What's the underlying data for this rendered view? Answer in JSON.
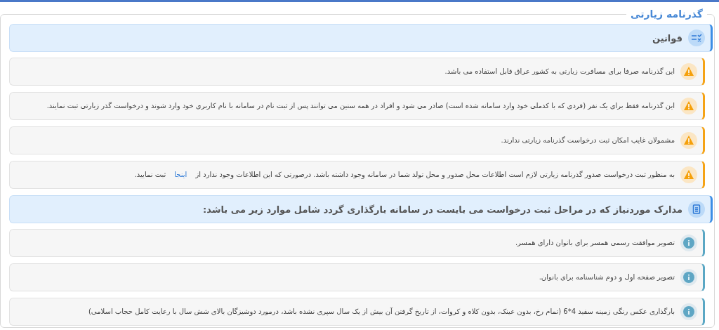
{
  "panel": {
    "title": "گذرنامه زیارتی"
  },
  "sections": [
    {
      "kind": "rules",
      "title": "قوانین",
      "items": [
        {
          "kind": "warning",
          "text": "این گذرنامه صرفا برای مسافرت زیارتی به کشور عراق قابل استفاده می باشد."
        },
        {
          "kind": "warning",
          "text": "این گذرنامه فقط برای یک نفر (فردی که با کدملی خود وارد سامانه شده است) صادر می شود و افراد در همه سنین می توانند پس از ثبت نام در سامانه با نام کاربری خود وارد شوند و درخواست گذر زیارتی ثبت نمایند."
        },
        {
          "kind": "warning",
          "text": "مشمولان غایب امکان ثبت درخواست گذرنامه زیارتی ندارند."
        },
        {
          "kind": "warning",
          "text": "به منظور ثبت درخواست صدور گذرنامه زیارتی لازم است اطلاعات محل صدور و محل تولد شما در سامانه وجود داشته باشد. درصورتی که این اطلاعات وجود ندارد از",
          "link": "اینجا",
          "text_after": "ثبت نمایید."
        }
      ]
    },
    {
      "kind": "documents",
      "title": "مدارک موردنیاز که در مراحل ثبت درخواست می بایست در سامانه بارگذاری گردد شامل موارد زیر می باشد:",
      "items": [
        {
          "kind": "info",
          "text": "تصویر موافقت رسمی همسر برای بانوان دارای همسر."
        },
        {
          "kind": "info",
          "text": "تصویر صفحه اول و دوم شناسنامه برای بانوان."
        },
        {
          "kind": "info",
          "text": "بارگذاری عکس رنگی زمینه سفید 4*6 (تمام رخ، بدون عینک، بدون کلاه و کروات، از تاریخ گرفتن آن بیش از یک سال سپری نشده باشد، درمورد دوشیزگان بالای شش سال با رعایت کامل حجاب اسلامی)"
        }
      ]
    }
  ]
}
